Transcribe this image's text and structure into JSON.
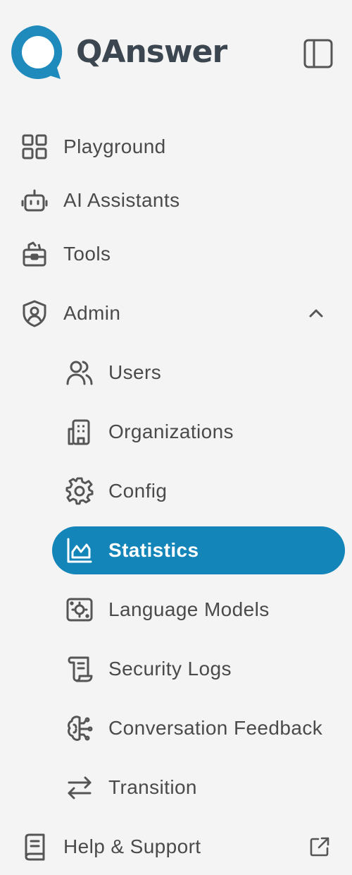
{
  "brand": {
    "name": "QAnswer",
    "logo_icon": "chat-bubble-logo",
    "accent": "#1385b8"
  },
  "nav": {
    "playground": {
      "label": "Playground",
      "icon": "grid-icon"
    },
    "assistants": {
      "label": "AI Assistants",
      "icon": "robot-icon"
    },
    "tools": {
      "label": "Tools",
      "icon": "toolbox-icon"
    },
    "admin": {
      "label": "Admin",
      "icon": "shield-user-icon",
      "expanded": true,
      "children": {
        "users": {
          "label": "Users",
          "icon": "users-icon"
        },
        "organizations": {
          "label": "Organizations",
          "icon": "building-icon"
        },
        "config": {
          "label": "Config",
          "icon": "gear-icon"
        },
        "statistics": {
          "label": "Statistics",
          "icon": "chart-icon",
          "active": true
        },
        "language_models": {
          "label": "Language Models",
          "icon": "model-chip-icon"
        },
        "security_logs": {
          "label": "Security Logs",
          "icon": "scroll-icon"
        },
        "feedback": {
          "label": "Conversation Feedback",
          "icon": "brain-icon"
        },
        "transition": {
          "label": "Transition",
          "icon": "arrows-swap-icon"
        }
      }
    },
    "help": {
      "label": "Help & Support",
      "icon": "book-icon",
      "external": true
    }
  },
  "colors": {
    "active_bg": "#1385b8",
    "active_text": "#ffffff",
    "text": "#4a4a4a",
    "icon": "#555555",
    "background": "#f4f4f4"
  }
}
